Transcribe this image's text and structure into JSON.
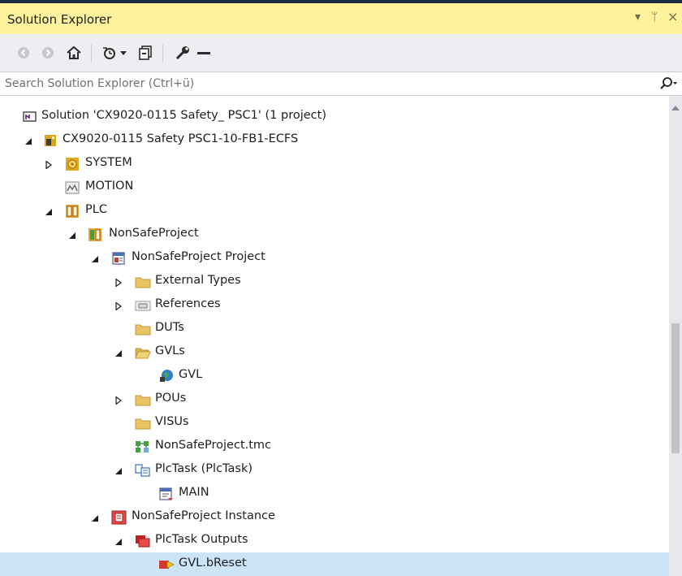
{
  "window": {
    "title": "Solution Explorer",
    "controls": {
      "dropdown": "▾",
      "pin": "ᛘ",
      "close": "×"
    }
  },
  "toolbar": {
    "buttons": [
      "back-icon",
      "forward-icon",
      "home-icon",
      "sync-icon",
      "dropdown-icon",
      "collapse-all-icon",
      "properties-icon",
      "show-all-icon"
    ]
  },
  "search": {
    "placeholder": "Search Solution Explorer (Ctrl+ü)"
  },
  "tree": {
    "items": [
      {
        "label": "Solution 'CX9020-0115 Safety_ PSC1' (1 project)",
        "icon": "solution-icon",
        "expander": "none"
      },
      {
        "label": "CX9020-0115 Safety PSC1-10-FB1-ECFS",
        "icon": "twincat-project-icon",
        "expander": "expanded"
      },
      {
        "label": "SYSTEM",
        "icon": "system-icon",
        "expander": "collapsed"
      },
      {
        "label": "MOTION",
        "icon": "motion-icon",
        "expander": "none"
      },
      {
        "label": "PLC",
        "icon": "plc-icon",
        "expander": "expanded"
      },
      {
        "label": "NonSafeProject",
        "icon": "plc-project-icon",
        "expander": "expanded"
      },
      {
        "label": "NonSafeProject Project",
        "icon": "project-file-icon",
        "expander": "expanded"
      },
      {
        "label": "External Types",
        "icon": "folder-icon",
        "expander": "collapsed"
      },
      {
        "label": "References",
        "icon": "references-icon",
        "expander": "collapsed"
      },
      {
        "label": "DUTs",
        "icon": "folder-icon",
        "expander": "none"
      },
      {
        "label": "GVLs",
        "icon": "folder-open-icon",
        "expander": "expanded"
      },
      {
        "label": "GVL",
        "icon": "gvl-globe-icon",
        "expander": "none"
      },
      {
        "label": "POUs",
        "icon": "folder-icon",
        "expander": "collapsed"
      },
      {
        "label": "VISUs",
        "icon": "folder-icon",
        "expander": "none"
      },
      {
        "label": "NonSafeProject.tmc",
        "icon": "tmc-file-icon",
        "expander": "none"
      },
      {
        "label": "PlcTask (PlcTask)",
        "icon": "task-icon",
        "expander": "expanded"
      },
      {
        "label": "MAIN",
        "icon": "pou-program-icon",
        "expander": "none"
      },
      {
        "label": "NonSafeProject Instance",
        "icon": "instance-icon",
        "expander": "expanded"
      },
      {
        "label": "PlcTask Outputs",
        "icon": "outputs-icon",
        "expander": "expanded"
      },
      {
        "label": "GVL.bReset",
        "icon": "output-variable-icon",
        "expander": "none",
        "selected": true
      }
    ]
  },
  "colors": {
    "title_bg": "#fff29d",
    "toolbar_bg": "#eeeef2",
    "selection_bg": "#cce4f7",
    "folder": "#e8c465",
    "scroll_thumb": "#c2c3c9"
  }
}
